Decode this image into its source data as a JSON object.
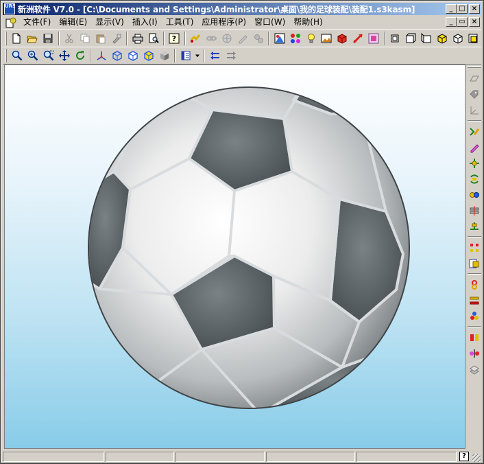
{
  "window": {
    "app_icon_text": "URS",
    "title": "新洲软件 V7.0 - [C:\\Documents and Settings\\Administrator\\桌面\\我的足球装配\\装配1.s3kasm]",
    "minimize": "_",
    "maximize": "□",
    "close": "×"
  },
  "menu": {
    "items": [
      "文件(F)",
      "编辑(E)",
      "显示(V)",
      "插入(I)",
      "工具(T)",
      "应用程序(P)",
      "窗口(W)",
      "帮助(H)"
    ],
    "mdi_minimize": "_",
    "mdi_restore": "▭",
    "mdi_close": "×"
  },
  "toolbar1": {
    "groups": [
      [
        "new-file-icon",
        "open-folder-icon",
        "save-disk-icon"
      ],
      [
        "cut-scissors-icon",
        "copy-icon",
        "paste-icon",
        "format-painter-icon"
      ],
      [
        "print-icon",
        "print-preview-icon"
      ],
      [
        "context-help-icon"
      ],
      [
        "snap-icon",
        "link-icon",
        "globe-icon",
        "sketch-pen-icon",
        "gear-parts-icon"
      ],
      [
        "palette-icon",
        "color-balls-icon",
        "light-bulb-icon",
        "background-image-icon",
        "render-cube-icon",
        "explode-arrow-icon",
        "material-icon"
      ],
      [
        "view-front-icon",
        "view-top-icon",
        "view-side-icon",
        "view-iso-shaded-icon",
        "view-iso-wire-icon",
        "view-iso-hidden-icon"
      ]
    ]
  },
  "toolbar2": {
    "groups": [
      [
        "zoom-icon",
        "zoom-in-icon",
        "zoom-window-icon",
        "pan-icon",
        "rotate-icon"
      ],
      [
        "axes-icon",
        "wireframe-cube-icon",
        "hidden-line-cube-icon",
        "shaded-edges-cube-icon",
        "shaded-cube-icon"
      ],
      [
        "view-list-icon",
        "view-dropdown-icon"
      ],
      [
        "undo-view-icon",
        "redo-view-icon"
      ]
    ]
  },
  "right_toolbar": {
    "groups": [
      [
        "plane-icon",
        "tag-icon",
        "coordinate-icon"
      ],
      [
        "place-part-icon",
        "edit-part-icon",
        "move-part-icon",
        "rotate-part-icon",
        "constraint-icon",
        "mate-icon",
        "align-icon"
      ],
      [
        "pattern-icon",
        "replace-part-icon"
      ],
      [
        "concentric-icon",
        "parallel-icon",
        "tangent-icon"
      ],
      [
        "insert-icon",
        "fix-icon",
        "section-icon"
      ]
    ]
  },
  "statusbar": {
    "panels": [
      "",
      "",
      "",
      "",
      ""
    ],
    "help": "?"
  },
  "colors": {
    "title_start": "#0a246a",
    "title_end": "#a6caf0",
    "chrome": "#d4d0c8",
    "ball_dark": "#5a6266",
    "ball_light": "#f2f2f2"
  }
}
